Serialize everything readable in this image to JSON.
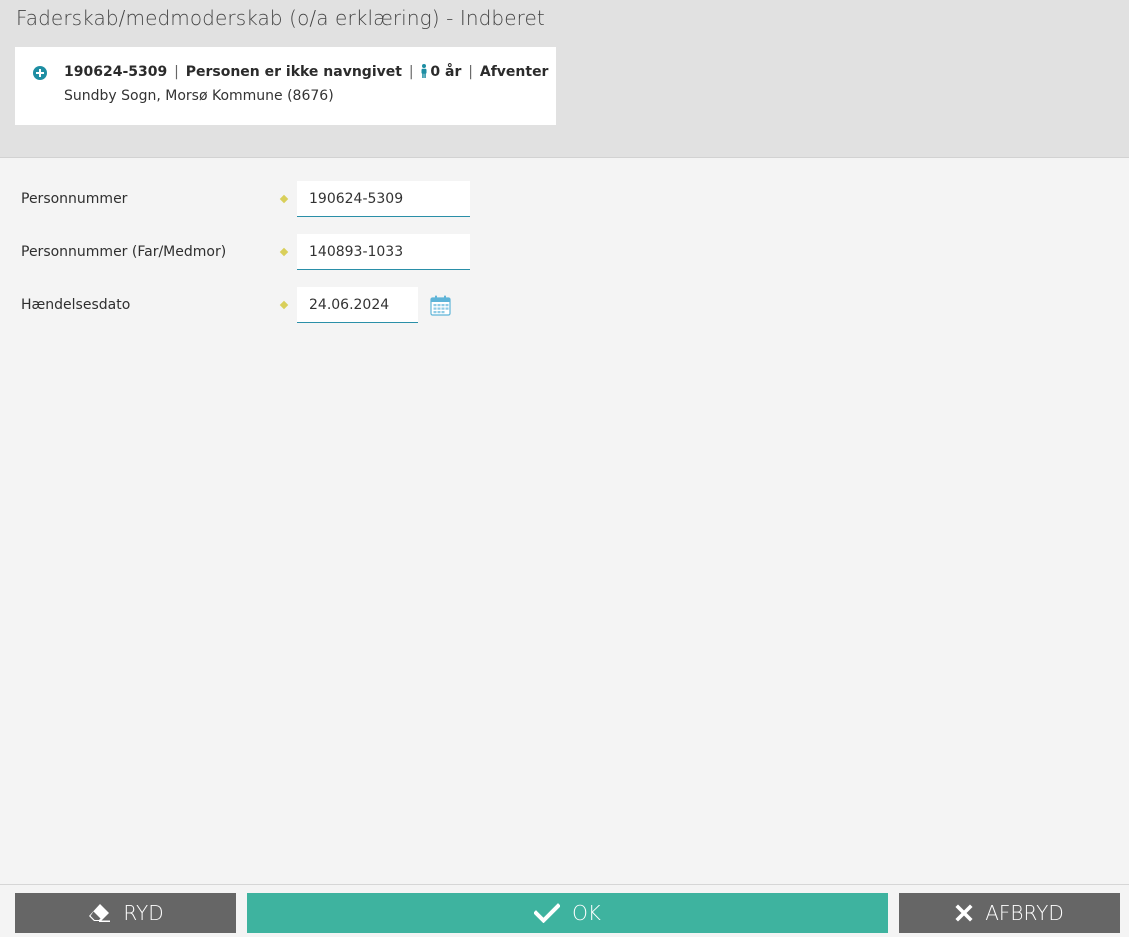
{
  "page": {
    "title": "Faderskab/medmoderskab (o/a erklæring) - Indberet"
  },
  "person_card": {
    "cpr": "190624-5309",
    "separator": "|",
    "name": "Personen er ikke navngivet",
    "age": "0 år",
    "status": "Afventer",
    "location": "Sundby Sogn, Morsø Kommune (8676)",
    "icons": {
      "expand": "plus-circle-icon",
      "person": "person-icon"
    }
  },
  "form": {
    "fields": [
      {
        "label": "Personnummer",
        "value": "190624-5309"
      },
      {
        "label": "Personnummer (Far/Medmor)",
        "value": "140893-1033"
      },
      {
        "label": "Hændelsesdato",
        "value": "24.06.2024"
      }
    ],
    "calendar_icon": "calendar-icon"
  },
  "footer": {
    "ryd_label": "RYD",
    "ok_label": "OK",
    "afbryd_label": "AFBRYD",
    "icons": {
      "ryd": "eraser-icon",
      "ok": "check-icon",
      "afbryd": "close-icon"
    }
  },
  "colors": {
    "accent_teal": "#3eb39f",
    "input_underline": "#2a8fa8",
    "icon_blue": "#1e8ea3",
    "required_marker": "#d9cf5a",
    "button_gray": "#666666",
    "header_bg": "#e1e1e1",
    "page_bg": "#f4f4f4"
  }
}
